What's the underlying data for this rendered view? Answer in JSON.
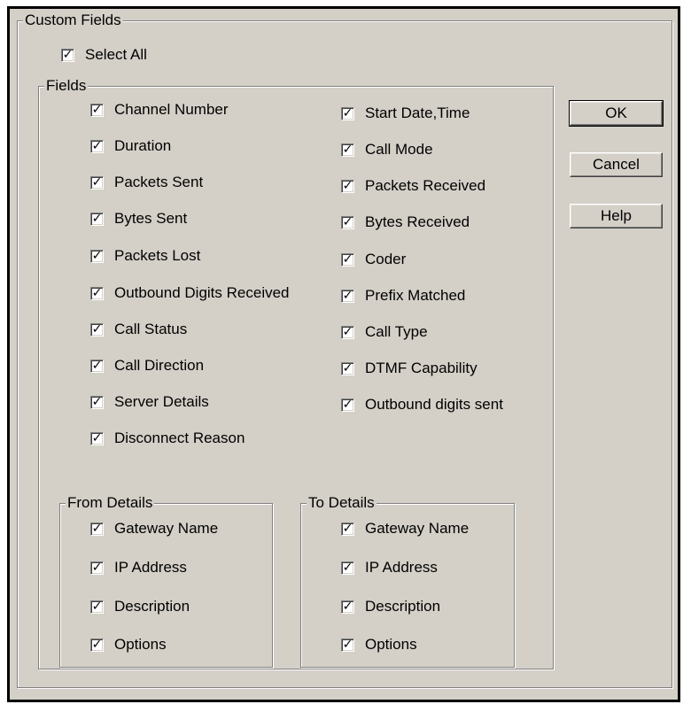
{
  "custom_fields": {
    "title": "Custom Fields",
    "select_all": {
      "label": "Select All",
      "checked": true
    }
  },
  "fields": {
    "title": "Fields",
    "left": [
      {
        "label": "Channel Number",
        "checked": true
      },
      {
        "label": "Duration",
        "checked": true
      },
      {
        "label": "Packets Sent",
        "checked": true
      },
      {
        "label": "Bytes Sent",
        "checked": true
      },
      {
        "label": "Packets Lost",
        "checked": true
      },
      {
        "label": "Outbound Digits Received",
        "checked": true
      },
      {
        "label": "Call Status",
        "checked": true
      },
      {
        "label": "Call Direction",
        "checked": true
      },
      {
        "label": "Server Details",
        "checked": true
      },
      {
        "label": "Disconnect Reason",
        "checked": true
      }
    ],
    "right": [
      {
        "label": "Start Date,Time",
        "checked": true
      },
      {
        "label": "Call Mode",
        "checked": true
      },
      {
        "label": "Packets Received",
        "checked": true
      },
      {
        "label": "Bytes Received",
        "checked": true
      },
      {
        "label": "Coder",
        "checked": true
      },
      {
        "label": "Prefix Matched",
        "checked": true
      },
      {
        "label": "Call Type",
        "checked": true
      },
      {
        "label": "DTMF Capability",
        "checked": true
      },
      {
        "label": "Outbound digits sent",
        "checked": true
      }
    ]
  },
  "from_details": {
    "title": "From Details",
    "items": [
      {
        "label": "Gateway Name",
        "checked": true
      },
      {
        "label": "IP Address",
        "checked": true
      },
      {
        "label": "Description",
        "checked": true
      },
      {
        "label": "Options",
        "checked": true
      }
    ]
  },
  "to_details": {
    "title": "To Details",
    "items": [
      {
        "label": "Gateway Name",
        "checked": true
      },
      {
        "label": "IP Address",
        "checked": true
      },
      {
        "label": "Description",
        "checked": true
      },
      {
        "label": "Options",
        "checked": true
      }
    ]
  },
  "buttons": {
    "ok": "OK",
    "cancel": "Cancel",
    "help": "Help"
  },
  "check_glyph": "✓"
}
